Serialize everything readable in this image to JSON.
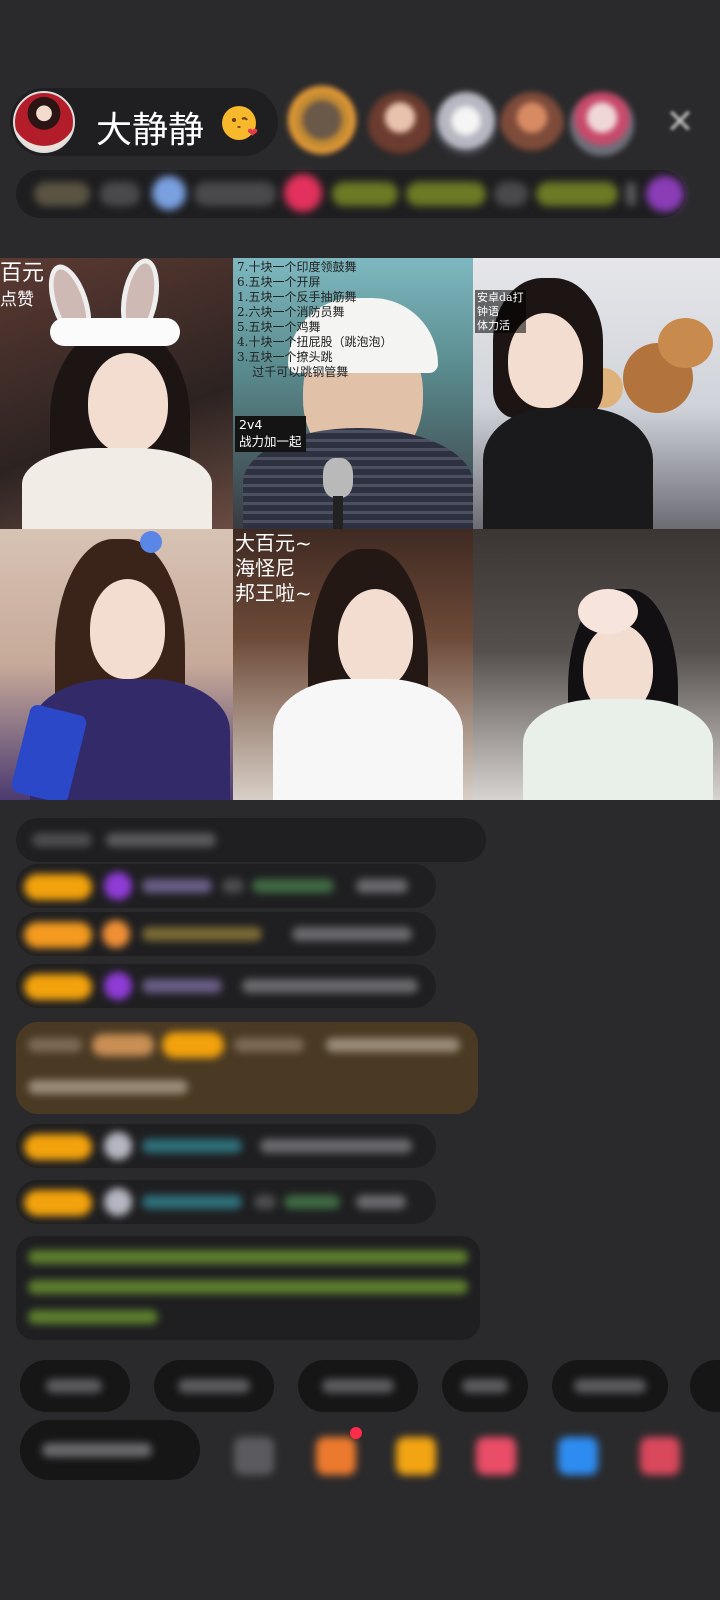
{
  "header": {
    "host_name": "大静静",
    "host_emoji": "kissing-face-emoji",
    "close_icon": "close-icon"
  },
  "video_grid": {
    "tiles": [
      {
        "id": "tile-1",
        "overlay_lines": [
          "百元",
          "点赞"
        ]
      },
      {
        "id": "tile-2",
        "overlay_lines": [
          "7.十块一个印度领鼓舞",
          "6.五块一个开屏",
          "1.五块一个反手抽筋舞",
          "2.六块一个消防员舞",
          "5.五块一个鸡舞",
          "4.十块一个扭屁股（跳泡泡）",
          "3.五块一个撩头跳",
          "    过千可以跳钢管舞"
        ],
        "caption_lines": [
          "2v4",
          "战力加一起"
        ]
      },
      {
        "id": "tile-3",
        "overlay_lines": [
          "安卓da打",
          "钟语",
          "体力活"
        ]
      },
      {
        "id": "tile-4",
        "overlay_lines": []
      },
      {
        "id": "tile-5",
        "overlay_lines": [
          "大百元~",
          "海怪尼",
          "邦王啦~"
        ]
      },
      {
        "id": "tile-6",
        "overlay_lines": []
      }
    ]
  },
  "colors": {
    "background": "#2a2a2c",
    "bubble": "#1f1f21",
    "badge_gold": "#f2a20c",
    "badge_orange": "#f39a1f",
    "purple_gem": "#8f3cd7",
    "teal_name": "#35a8bd",
    "green_text": "#8fc73a",
    "highlight_brown": "#4a3a24"
  }
}
